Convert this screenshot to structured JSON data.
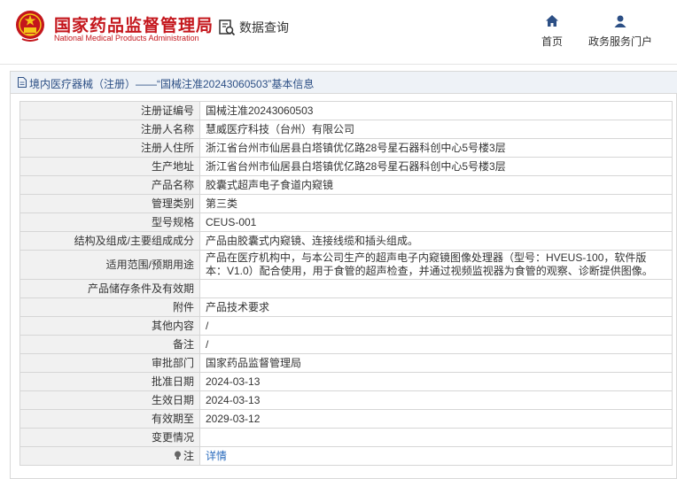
{
  "header": {
    "title": "国家药品监督管理局",
    "subtitle": "National Medical Products Administration",
    "query_label": "数据查询",
    "nav": [
      {
        "label": "首页",
        "icon": "home-icon"
      },
      {
        "label": "政务服务门户",
        "icon": "user-icon"
      }
    ]
  },
  "colors": {
    "brand": "#c4161c",
    "link": "#2a6bbd",
    "panel_title": "#2c4f85"
  },
  "panel": {
    "title": "境内医疗器械（注册）——“国械注准20243060503”基本信息"
  },
  "rows": [
    {
      "label": "注册证编号",
      "value": "国械注准20243060503"
    },
    {
      "label": "注册人名称",
      "value": "慧威医疗科技（台州）有限公司"
    },
    {
      "label": "注册人住所",
      "value": "浙江省台州市仙居县白塔镇优亿路28号星石器科创中心5号楼3层"
    },
    {
      "label": "生产地址",
      "value": "浙江省台州市仙居县白塔镇优亿路28号星石器科创中心5号楼3层"
    },
    {
      "label": "产品名称",
      "value": "胶囊式超声电子食道内窥镜"
    },
    {
      "label": "管理类别",
      "value": "第三类"
    },
    {
      "label": "型号规格",
      "value": "CEUS-001"
    },
    {
      "label": "结构及组成/主要组成成分",
      "value": "产品由胶囊式内窥镜、连接线缆和插头组成。"
    },
    {
      "label": "适用范围/预期用途",
      "value": "产品在医疗机构中，与本公司生产的超声电子内窥镜图像处理器（型号：HVEUS-100，软件版本：V1.0）配合使用，用于食管的超声检查，并通过视频监视器为食管的观察、诊断提供图像。"
    },
    {
      "label": "产品储存条件及有效期",
      "value": ""
    },
    {
      "label": "附件",
      "value": "产品技术要求"
    },
    {
      "label": "其他内容",
      "value": "/"
    },
    {
      "label": "备注",
      "value": "/"
    },
    {
      "label": "审批部门",
      "value": "国家药品监督管理局"
    },
    {
      "label": "批准日期",
      "value": "2024-03-13"
    },
    {
      "label": "生效日期",
      "value": "2024-03-13"
    },
    {
      "label": "有效期至",
      "value": "2029-03-12"
    },
    {
      "label": "变更情况",
      "value": ""
    }
  ],
  "note": {
    "label": "注",
    "link": "详情"
  }
}
